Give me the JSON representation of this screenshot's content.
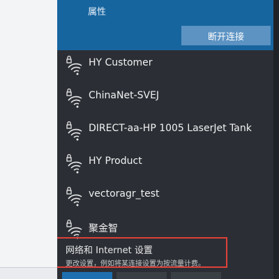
{
  "connected": {
    "properties_label": "属性",
    "disconnect_label": "断开连接"
  },
  "networks": [
    {
      "name": "HY Customer",
      "icon": "wifi-secured-icon"
    },
    {
      "name": "ChinaNet-SVEJ",
      "icon": "wifi-secured-icon"
    },
    {
      "name": "DIRECT-aa-HP 1005 LaserJet Tank",
      "icon": "wifi-secured-icon"
    },
    {
      "name": "HY Product",
      "icon": "wifi-secured-icon"
    },
    {
      "name": "vectoragr_test",
      "icon": "wifi-secured-icon"
    },
    {
      "name": "聚金智",
      "icon": "wifi-secured-icon"
    }
  ],
  "settings": {
    "title": "网络和 Internet 设置",
    "description": "更改设置，例如将某连接设置为按流量计费。"
  },
  "colors": {
    "accent": "#17659f",
    "panel_bg": "#2b2f35",
    "highlight_border": "#e0403a"
  }
}
